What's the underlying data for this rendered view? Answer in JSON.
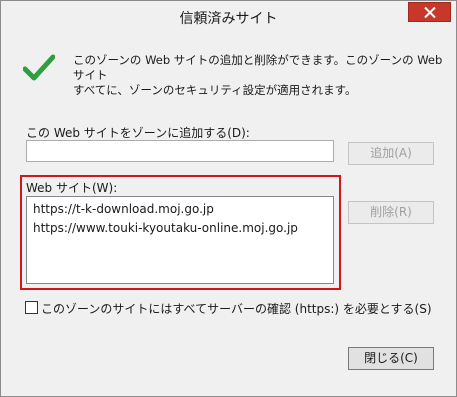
{
  "window": {
    "title": "信頼済みサイト"
  },
  "info": {
    "line1": "このゾーンの Web サイトの追加と削除ができます。このゾーンの Web サイト",
    "line2": "すべてに、ゾーンのセキュリティ設定が適用されます。"
  },
  "add_site": {
    "label": "この Web サイトをゾーンに追加する(D):",
    "value": "",
    "button_label": "追加(A)"
  },
  "websites": {
    "label": "Web サイト(W):",
    "items": [
      "https://t-k-download.moj.go.jp",
      "https://www.touki-kyoutaku-online.moj.go.jp"
    ],
    "remove_label": "削除(R)"
  },
  "https_requirement": {
    "label": "このゾーンのサイトにはすべてサーバーの確認 (https:) を必要とする(S)",
    "checked": false
  },
  "footer": {
    "close_label": "閉じる(C)"
  },
  "icons": {
    "window_close": "close-icon",
    "info": "checkmark-icon"
  },
  "colors": {
    "highlight_border": "#d0171b",
    "close_button": "#c7382b",
    "checkmark": "#2e9e3e"
  }
}
